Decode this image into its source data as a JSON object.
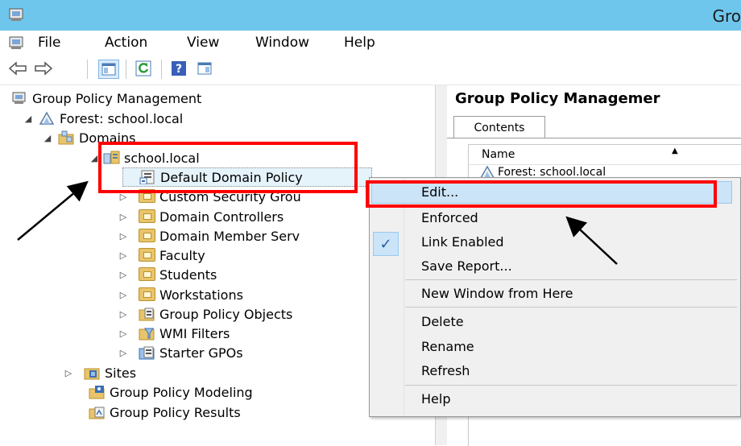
{
  "window": {
    "title": "Gro"
  },
  "menubar": {
    "items": [
      "File",
      "Action",
      "View",
      "Window",
      "Help"
    ]
  },
  "toolbar": {
    "buttons": [
      "back-arrow-icon",
      "forward-arrow-icon",
      "show-hide-console-tree-icon",
      "refresh-icon",
      "help-icon",
      "show-hide-action-pane-icon"
    ]
  },
  "tree": {
    "root": "Group Policy Management",
    "forest": "Forest: school.local",
    "domains": "Domains",
    "domain": "school.local",
    "children": [
      "Default Domain Policy",
      "Custom Security Grou",
      "Domain Controllers",
      "Domain Member Serv",
      "Faculty",
      "Students",
      "Workstations",
      "Group Policy Objects",
      "WMI Filters",
      "Starter GPOs"
    ],
    "sites": "Sites",
    "modeling": "Group Policy Modeling",
    "results": "Group Policy Results"
  },
  "right_pane": {
    "header": "Group Policy Managemer",
    "tab": "Contents",
    "column": "Name",
    "row": "Forest: school.local"
  },
  "context_menu": {
    "items": [
      {
        "label": "Edit...",
        "highlighted": true
      },
      {
        "label": "Enforced"
      },
      {
        "label": "Link Enabled",
        "checked": true
      },
      {
        "label": "Save Report..."
      },
      {
        "label": "New Window from Here"
      },
      {
        "label": "Delete"
      },
      {
        "label": "Rename"
      },
      {
        "label": "Refresh"
      },
      {
        "label": "Help"
      }
    ],
    "check_glyph": "✓"
  },
  "colors": {
    "titlebar": "#6fc6ec",
    "annotation": "#ff0000",
    "highlight": "#cce4f7"
  }
}
